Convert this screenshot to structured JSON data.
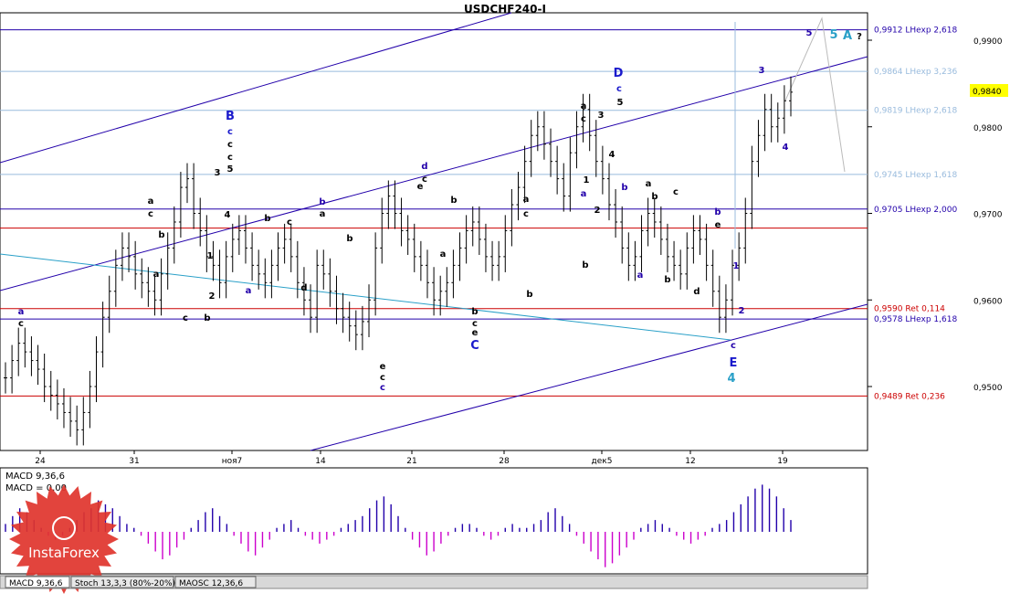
{
  "chart_data": {
    "type": "candlestick",
    "title": "USDCHF240-I",
    "x_ticks": [
      "24",
      "31",
      "ноя7",
      "14",
      "21",
      "28",
      "дек5",
      "12",
      "19"
    ],
    "y_ticks": [
      "0,9900",
      "0,9800",
      "0,9700",
      "0,9600",
      "0,9500"
    ],
    "last_price": "0,9840",
    "levels": [
      {
        "price": 0.9912,
        "label": "0,9912 LHexp 2,618",
        "color": "#2200aa"
      },
      {
        "price": 0.9864,
        "label": "0,9864 LHexp 3,236",
        "color": "#99bbdd"
      },
      {
        "price": 0.9819,
        "label": "0,9819 LHexp 2,618",
        "color": "#99bbdd"
      },
      {
        "price": 0.9745,
        "label": "0,9745 LHexp 1,618",
        "color": "#99bbdd"
      },
      {
        "price": 0.9705,
        "label": "0,9705 LHexp 2,000",
        "color": "#2200aa"
      },
      {
        "price": 0.959,
        "label": "0,9590 Ret 0,114",
        "color": "#cc0000"
      },
      {
        "price": 0.9578,
        "label": "0,9578 LHexp 1,618",
        "color": "#2200aa"
      },
      {
        "price": 0.9489,
        "label": "0,9489 Ret 0,236",
        "color": "#cc0000"
      }
    ],
    "unlabeled_level": {
      "price": 0.9683,
      "color": "#cc0000"
    },
    "closes": [
      0.951,
      0.953,
      0.955,
      0.954,
      0.953,
      0.952,
      0.95,
      0.949,
      0.948,
      0.947,
      0.946,
      0.945,
      0.947,
      0.95,
      0.954,
      0.958,
      0.961,
      0.964,
      0.966,
      0.965,
      0.963,
      0.962,
      0.961,
      0.96,
      0.963,
      0.966,
      0.969,
      0.973,
      0.974,
      0.97,
      0.968,
      0.965,
      0.964,
      0.962,
      0.965,
      0.967,
      0.968,
      0.966,
      0.964,
      0.963,
      0.962,
      0.964,
      0.966,
      0.967,
      0.965,
      0.962,
      0.96,
      0.958,
      0.964,
      0.963,
      0.961,
      0.959,
      0.958,
      0.957,
      0.956,
      0.9575,
      0.96,
      0.966,
      0.97,
      0.972,
      0.97,
      0.968,
      0.967,
      0.965,
      0.964,
      0.962,
      0.96,
      0.961,
      0.962,
      0.964,
      0.966,
      0.968,
      0.969,
      0.967,
      0.965,
      0.964,
      0.965,
      0.968,
      0.971,
      0.973,
      0.976,
      0.979,
      0.98,
      0.978,
      0.976,
      0.974,
      0.972,
      0.977,
      0.98,
      0.982,
      0.979,
      0.976,
      0.974,
      0.971,
      0.969,
      0.966,
      0.964,
      0.965,
      0.968,
      0.97,
      0.969,
      0.967,
      0.965,
      0.964,
      0.963,
      0.966,
      0.968,
      0.967,
      0.964,
      0.961,
      0.958,
      0.96,
      0.964,
      0.966,
      0.97,
      0.976,
      0.979,
      0.982,
      0.98,
      0.981,
      0.983,
      0.984
    ],
    "wave_labels": [
      {
        "text": "a",
        "color": "#2200aa"
      },
      {
        "text": "c",
        "color": "#000000"
      },
      {
        "text": "B",
        "color": "#1a1acc"
      },
      {
        "text": "c",
        "color": "#1a1acc"
      },
      {
        "text": "c",
        "color": "#000000"
      },
      {
        "text": "c",
        "color": "#000000"
      },
      {
        "text": "5",
        "color": "#000000"
      },
      {
        "text": "3",
        "color": "#000000"
      },
      {
        "text": "4",
        "color": "#000000"
      },
      {
        "text": "a",
        "color": "#000000"
      },
      {
        "text": "c",
        "color": "#000000"
      },
      {
        "text": "b",
        "color": "#000000"
      },
      {
        "text": "a",
        "color": "#000000"
      },
      {
        "text": "1",
        "color": "#000000"
      },
      {
        "text": "2",
        "color": "#000000"
      },
      {
        "text": "b",
        "color": "#000000"
      },
      {
        "text": "c",
        "color": "#000000"
      },
      {
        "text": "b",
        "color": "#000000"
      },
      {
        "text": "a",
        "color": "#2200aa"
      },
      {
        "text": "b",
        "color": "#2200aa"
      },
      {
        "text": "a",
        "color": "#000000"
      },
      {
        "text": "c",
        "color": "#000000"
      },
      {
        "text": "b",
        "color": "#000000"
      },
      {
        "text": "d",
        "color": "#000000"
      },
      {
        "text": "e",
        "color": "#000000"
      },
      {
        "text": "c",
        "color": "#000000"
      },
      {
        "text": "c",
        "color": "#2200aa"
      },
      {
        "text": "d",
        "color": "#2200aa"
      },
      {
        "text": "c",
        "color": "#000000"
      },
      {
        "text": "e",
        "color": "#000000"
      },
      {
        "text": "b",
        "color": "#000000"
      },
      {
        "text": "a",
        "color": "#000000"
      },
      {
        "text": "b",
        "color": "#000000"
      },
      {
        "text": "c",
        "color": "#000000"
      },
      {
        "text": "e",
        "color": "#000000"
      },
      {
        "text": "C",
        "color": "#1a1acc"
      },
      {
        "text": "a",
        "color": "#000000"
      },
      {
        "text": "c",
        "color": "#000000"
      },
      {
        "text": "b",
        "color": "#000000"
      },
      {
        "text": "a",
        "color": "#000000"
      },
      {
        "text": "c",
        "color": "#000000"
      },
      {
        "text": "b",
        "color": "#000000"
      },
      {
        "text": "a",
        "color": "#2200aa"
      },
      {
        "text": "D",
        "color": "#1a1acc"
      },
      {
        "text": "c",
        "color": "#1a1acc"
      },
      {
        "text": "5",
        "color": "#000000"
      },
      {
        "text": "3",
        "color": "#000000"
      },
      {
        "text": "4",
        "color": "#000000"
      },
      {
        "text": "1",
        "color": "#000000"
      },
      {
        "text": "2",
        "color": "#000000"
      },
      {
        "text": "b",
        "color": "#2200aa"
      },
      {
        "text": "a",
        "color": "#000000"
      },
      {
        "text": "b",
        "color": "#000000"
      },
      {
        "text": "c",
        "color": "#000000"
      },
      {
        "text": "a",
        "color": "#2200aa"
      },
      {
        "text": "b",
        "color": "#000000"
      },
      {
        "text": "d",
        "color": "#000000"
      },
      {
        "text": "b",
        "color": "#2200aa"
      },
      {
        "text": "e",
        "color": "#000000"
      },
      {
        "text": "1",
        "color": "#2200aa"
      },
      {
        "text": "2",
        "color": "#2200aa"
      },
      {
        "text": "c",
        "color": "#2200aa"
      },
      {
        "text": "E",
        "color": "#1a1acc"
      },
      {
        "text": "4",
        "color": "#2aa0c8"
      },
      {
        "text": "3",
        "color": "#2200aa"
      },
      {
        "text": "4",
        "color": "#2200aa"
      },
      {
        "text": "5",
        "color": "#2200aa"
      },
      {
        "text": "5",
        "color": "#2aa0c8"
      },
      {
        "text": "A",
        "color": "#2aa0c8"
      },
      {
        "text": "?",
        "color": "#000000"
      }
    ],
    "indicator": {
      "lines": [
        "MACD 9,36,6",
        "MACD = 0,00"
      ],
      "positive_color": "#2200aa",
      "negative_color": "#cc00cc",
      "values": [
        2,
        4,
        6,
        5,
        3,
        1,
        -1,
        -2,
        -1,
        1,
        3,
        5,
        6,
        8,
        7,
        6,
        4,
        2,
        1,
        -1,
        -3,
        -5,
        -7,
        -6,
        -4,
        -2,
        1,
        3,
        5,
        6,
        4,
        2,
        -1,
        -3,
        -5,
        -6,
        -4,
        -2,
        1,
        2,
        3,
        1,
        -1,
        -2,
        -3,
        -2,
        -1,
        1,
        2,
        3,
        4,
        6,
        8,
        9,
        7,
        4,
        1,
        -2,
        -4,
        -6,
        -5,
        -3,
        -1,
        1,
        2,
        2,
        1,
        -1,
        -2,
        -1,
        1,
        2,
        1,
        1,
        2,
        3,
        5,
        6,
        4,
        2,
        -1,
        -3,
        -5,
        -7,
        -9,
        -8,
        -6,
        -4,
        -2,
        1,
        2,
        3,
        2,
        1,
        -1,
        -2,
        -3,
        -2,
        -1,
        1,
        2,
        3,
        5,
        7,
        9,
        11,
        12,
        11,
        9,
        6,
        3
      ]
    },
    "tabs": [
      "MACD 9,36,6",
      "Stoch 13,3,3 (80%-20%)",
      "MAOSC 12,36,6"
    ],
    "watermark": "InstaForex"
  }
}
